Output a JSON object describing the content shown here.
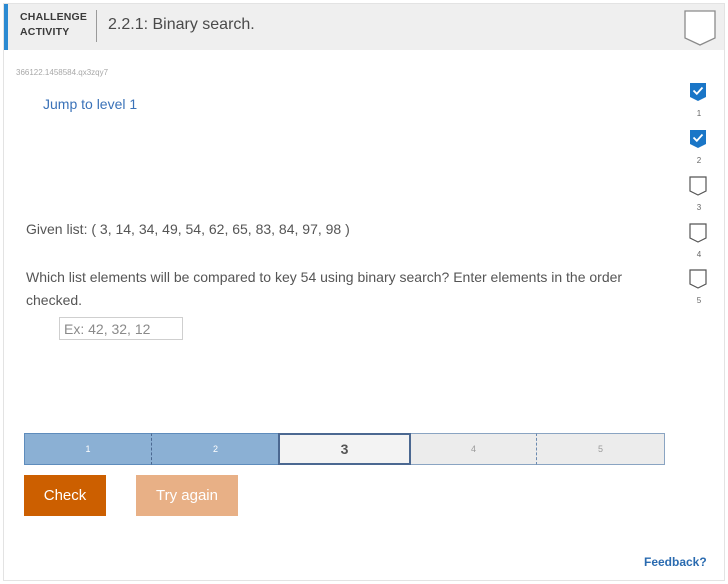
{
  "header": {
    "activity_type_line1": "CHALLENGE",
    "activity_type_line2": "ACTIVITY",
    "title": "2.2.1: Binary search.",
    "accent_color": "#2b8ad2"
  },
  "activity_id": "366122.1458584.qx3zqy7",
  "jump_link": "Jump to level 1",
  "question": {
    "given": "Given list: ( 3, 14, 34, 49, 54, 62, 65, 83, 84, 97, 98 )",
    "prompt": "Which list elements will be compared to key 54 using binary search? Enter elements in the order checked.",
    "answer_value": "",
    "answer_placeholder": "Ex: 42, 32, 12"
  },
  "levels": [
    {
      "label": "1",
      "state": "completed"
    },
    {
      "label": "2",
      "state": "completed"
    },
    {
      "label": "3",
      "state": "current"
    },
    {
      "label": "4",
      "state": "locked"
    },
    {
      "label": "5",
      "state": "locked"
    }
  ],
  "buttons": {
    "check": "Check",
    "try_again": "Try again",
    "check_color": "#cc5f00",
    "try_again_color": "#e8b086"
  },
  "steps": [
    {
      "label": "1",
      "completed": true
    },
    {
      "label": "2",
      "completed": true
    },
    {
      "label": "3",
      "completed": false
    },
    {
      "label": "4",
      "completed": false
    },
    {
      "label": "5",
      "completed": false
    }
  ],
  "feedback_link": "Feedback?"
}
